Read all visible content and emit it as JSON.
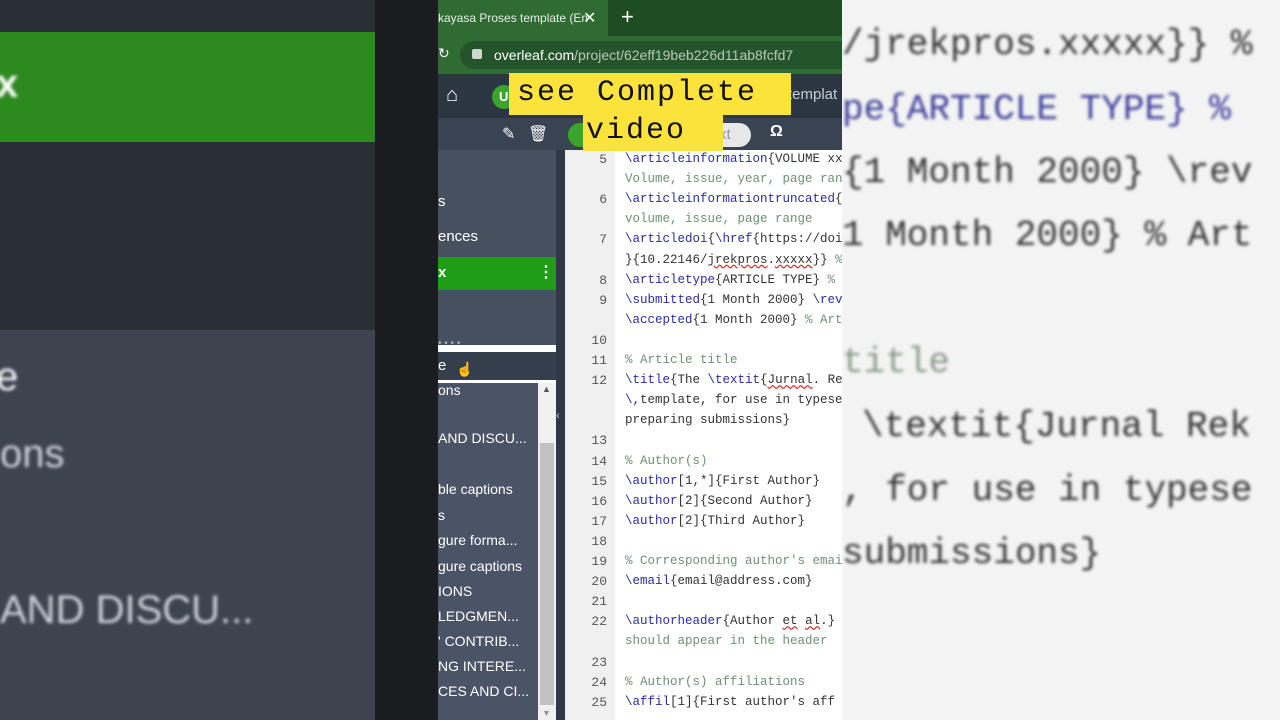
{
  "browser": {
    "tab_title": "kayasa Proses template (En",
    "close": "✕",
    "new_tab": "+",
    "reload": "↻",
    "url_host": "overleaf.com",
    "url_path": "/project/62eff19beb226d11ab8fcfd7"
  },
  "toolbar": {
    "home": "⌂",
    "pill": "U",
    "project_name": "templat",
    "pencil": "✎",
    "trash": "🗑",
    "toggle_right": "xt",
    "omega": "Ω"
  },
  "overlay": {
    "line1": "see Complete",
    "line2": "video"
  },
  "file_tree": {
    "items": [
      {
        "label": "s"
      },
      {
        "label": "ences"
      },
      {
        "label": "x",
        "selected": true
      }
    ],
    "kebab": "⋮",
    "dots": "• • • •"
  },
  "outline": {
    "header": "e",
    "items": [
      "ons",
      "AND DISCU...",
      "ble captions",
      "s",
      "gure forma...",
      "gure captions",
      "IONS",
      "LEDGMEN...",
      "' CONTRIB...",
      "NG INTERE...",
      "CES AND CI..."
    ]
  },
  "editor": {
    "lines": [
      {
        "n": "5",
        "parts": [
          [
            "kw",
            "\\articleinformation"
          ],
          [
            "",
            "{VOLUME xx"
          ]
        ]
      },
      {
        "n": "",
        "parts": [
          [
            "cm",
            "Volume, issue, year, page ran"
          ]
        ]
      },
      {
        "n": "6",
        "parts": [
          [
            "kw",
            "\\articleinformationtruncated"
          ],
          [
            "",
            "{"
          ]
        ]
      },
      {
        "n": "",
        "parts": [
          [
            "cm",
            "volume, issue, page range"
          ]
        ]
      },
      {
        "n": "7",
        "parts": [
          [
            "kw",
            "\\articledoi"
          ],
          [
            "",
            "{"
          ],
          [
            "kw",
            "\\href"
          ],
          [
            "",
            "{https://doi"
          ]
        ]
      },
      {
        "n": "",
        "parts": [
          [
            "",
            "}{10.22146/"
          ],
          [
            "sq",
            "jrekpros"
          ],
          [
            "",
            "."
          ],
          [
            "sq",
            "xxxxx"
          ],
          [
            "",
            "}} "
          ],
          [
            "cm",
            "%"
          ]
        ]
      },
      {
        "n": "8",
        "parts": [
          [
            "kw",
            "\\articletype"
          ],
          [
            "",
            "{ARTICLE TYPE} "
          ],
          [
            "cm",
            "%"
          ]
        ]
      },
      {
        "n": "9",
        "parts": [
          [
            "kw",
            "\\submitted"
          ],
          [
            "",
            "{1 Month 2000} "
          ],
          [
            "kw",
            "\\rev"
          ]
        ]
      },
      {
        "n": "",
        "parts": [
          [
            "kw",
            "\\accepted"
          ],
          [
            "",
            "{1 Month 2000} "
          ],
          [
            "cm",
            "% Art"
          ]
        ]
      },
      {
        "n": "10",
        "parts": []
      },
      {
        "n": "11",
        "parts": [
          [
            "cm",
            "% Article title"
          ]
        ]
      },
      {
        "n": "12",
        "parts": [
          [
            "kw",
            "\\title"
          ],
          [
            "",
            "{The "
          ],
          [
            "kw",
            "\\textit"
          ],
          [
            "",
            "{"
          ],
          [
            "sq",
            "Jurnal"
          ],
          [
            "",
            ". Rek"
          ]
        ]
      },
      {
        "n": "",
        "parts": [
          [
            "kw",
            "\\,"
          ],
          [
            "",
            "template, for use in typese"
          ]
        ]
      },
      {
        "n": "",
        "parts": [
          [
            "",
            "preparing submissions}"
          ]
        ]
      },
      {
        "n": "13",
        "parts": []
      },
      {
        "n": "14",
        "parts": [
          [
            "cm",
            "% Author(s)"
          ]
        ]
      },
      {
        "n": "15",
        "parts": [
          [
            "kw",
            "\\author"
          ],
          [
            "",
            "[1,*]{First Author}"
          ]
        ]
      },
      {
        "n": "16",
        "parts": [
          [
            "kw",
            "\\author"
          ],
          [
            "",
            "[2]{Second Author}"
          ]
        ]
      },
      {
        "n": "17",
        "parts": [
          [
            "kw",
            "\\author"
          ],
          [
            "",
            "[2]{Third Author}"
          ]
        ]
      },
      {
        "n": "18",
        "parts": []
      },
      {
        "n": "19",
        "parts": [
          [
            "cm",
            "% Corresponding author's emai"
          ]
        ]
      },
      {
        "n": "20",
        "parts": [
          [
            "kw",
            "\\email"
          ],
          [
            "",
            "{email@address.com}"
          ]
        ]
      },
      {
        "n": "21",
        "parts": []
      },
      {
        "n": "22",
        "parts": [
          [
            "kw",
            "\\authorheader"
          ],
          [
            "",
            "{Author "
          ],
          [
            "sq",
            "et"
          ],
          [
            "",
            " "
          ],
          [
            "sq",
            "al"
          ],
          [
            "",
            ".}"
          ]
        ]
      },
      {
        "n": "",
        "parts": [
          [
            "cm",
            "should appear in the header"
          ]
        ]
      },
      {
        "n": "23",
        "parts": []
      },
      {
        "n": "24",
        "parts": [
          [
            "cm",
            "% Author(s) affiliations"
          ]
        ]
      },
      {
        "n": "25",
        "parts": [
          [
            "kw",
            "\\affil"
          ],
          [
            "",
            "[1]{First author's aff"
          ]
        ]
      }
    ]
  },
  "bg_left": {
    "texts": [
      "x",
      "e",
      "ons",
      "AND DISCU..."
    ]
  },
  "bg_right": {
    "texts": [
      "/jrekpros.xxxxx}} %",
      "pe{ARTICLE TYPE} %",
      "{1 Month 2000} \\rev",
      "1 Month 2000} % Art",
      "title",
      "\\textit{Jurnal Rek",
      ", for use in typese",
      "submissions}"
    ]
  },
  "colors": {
    "overleaf_green": "#1f9d17",
    "overlay_yellow": "#fbe33c",
    "browser_green": "#2f6b33"
  }
}
